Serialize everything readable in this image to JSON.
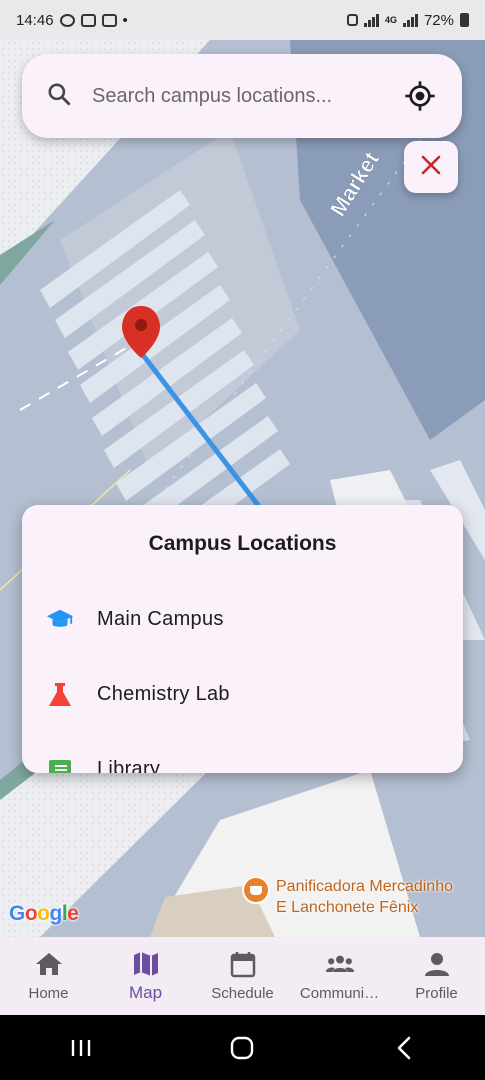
{
  "status_bar": {
    "time": "14:46",
    "dot": "•",
    "network": "4G",
    "battery": "72%"
  },
  "search": {
    "placeholder": "Search campus locations..."
  },
  "map": {
    "street_label": "Market",
    "poi": {
      "line1": "Panificadora Mercadinho",
      "line2": "E Lanchonete Fênix"
    },
    "google": [
      "G",
      "o",
      "o",
      "g",
      "l",
      "e"
    ],
    "google_colors": [
      "#4285f4",
      "#ea4335",
      "#fbbc05",
      "#4285f4",
      "#34a853",
      "#ea4335"
    ]
  },
  "panel": {
    "title": "Campus Locations",
    "items": [
      {
        "label": "Main Campus",
        "icon": "school-icon",
        "color": "#2196f3"
      },
      {
        "label": "Chemistry Lab",
        "icon": "flask-icon",
        "color": "#f44336"
      },
      {
        "label": "Library",
        "icon": "book-icon",
        "color": "#4caf50"
      }
    ]
  },
  "nav": {
    "items": [
      {
        "label": "Home",
        "icon": "home-icon"
      },
      {
        "label": "Map",
        "icon": "map-icon",
        "active": true
      },
      {
        "label": "Schedule",
        "icon": "calendar-icon"
      },
      {
        "label": "Communi…",
        "icon": "people-icon"
      },
      {
        "label": "Profile",
        "icon": "person-icon"
      }
    ]
  },
  "colors": {
    "accent": "#6c4ea0",
    "route": "#3b93e6",
    "marker": "#d93025",
    "close": "#c62828"
  }
}
